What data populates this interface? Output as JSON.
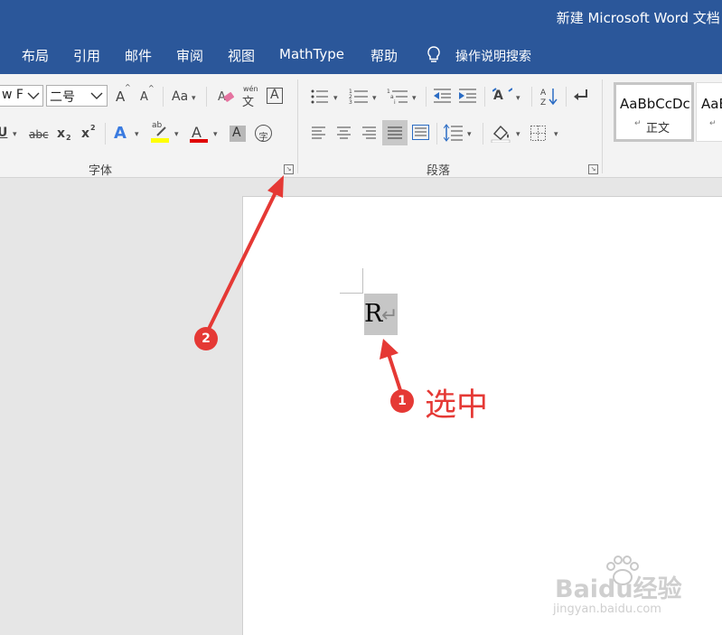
{
  "window": {
    "title": "新建 Microsoft Word 文档 -"
  },
  "menu": {
    "items": [
      "布局",
      "引用",
      "邮件",
      "审阅",
      "视图",
      "MathType",
      "帮助"
    ],
    "search_label": "操作说明搜索"
  },
  "ribbon": {
    "font_group": {
      "label": "字体",
      "font_name": "w F",
      "font_size": "二号",
      "grow_font": "A",
      "shrink_font": "A",
      "change_case": "Aa",
      "phonetic_top": "wén",
      "phonetic_bottom": "文",
      "char_border": "A",
      "underline": "U",
      "strikethrough": "abc",
      "subscript": "x",
      "subscript_digit": "2",
      "superscript": "x",
      "superscript_digit": "2",
      "text_effects": "A",
      "highlight_top": "ab",
      "font_color": "A",
      "char_shading": "A",
      "enclose_char": "字"
    },
    "paragraph_group": {
      "label": "段落"
    },
    "styles": {
      "normal_preview": "AaBbCcDc",
      "normal_label": "正文",
      "next_preview": "AaB"
    }
  },
  "document": {
    "char": "R",
    "paragraph_mark": "↵"
  },
  "annotations": {
    "badge_1": "1",
    "badge_2": "2",
    "select_label": "选中"
  },
  "watermark": {
    "line1": "Baidu经验",
    "line2": "jingyan.baidu.com"
  },
  "colors": {
    "title_blue": "#2b579a",
    "annotation_red": "#e53935",
    "highlight_yellow": "#ffff00",
    "font_color_red": "#e00000"
  }
}
